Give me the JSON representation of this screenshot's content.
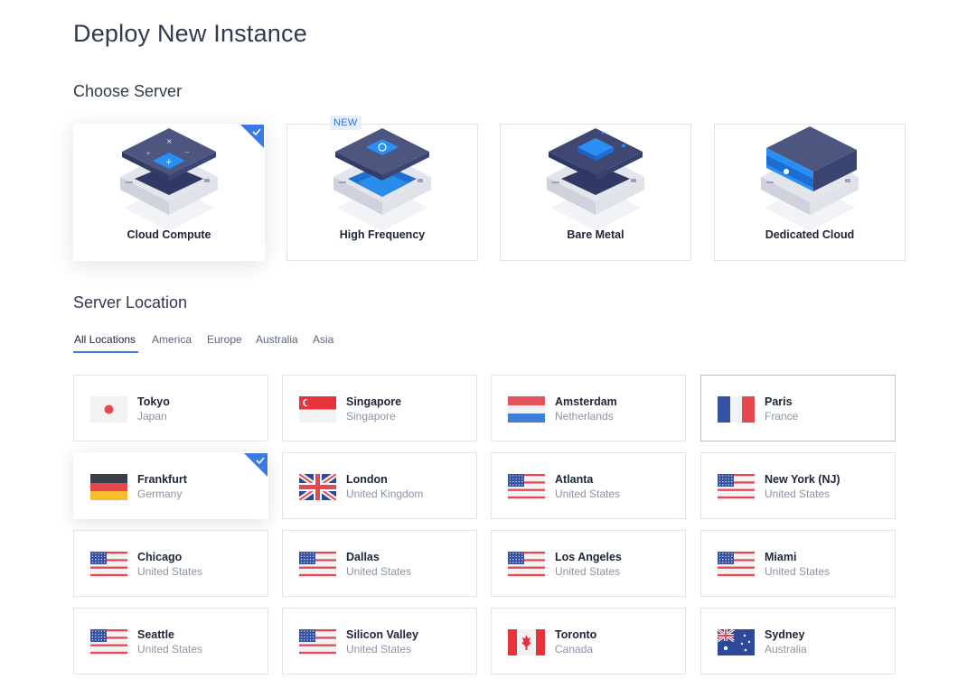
{
  "page": {
    "title": "Deploy New Instance"
  },
  "server": {
    "section_title": "Choose Server",
    "cards": [
      {
        "label": "Cloud Compute",
        "selected": true
      },
      {
        "label": "High Frequency",
        "badge": "NEW"
      },
      {
        "label": "Bare Metal"
      },
      {
        "label": "Dedicated Cloud"
      }
    ]
  },
  "location": {
    "section_title": "Server Location",
    "tabs": [
      "All Locations",
      "America",
      "Europe",
      "Australia",
      "Asia"
    ],
    "active_tab": "All Locations",
    "items": [
      {
        "city": "Tokyo",
        "country": "Japan",
        "flag": "japan-flag-icon"
      },
      {
        "city": "Singapore",
        "country": "Singapore",
        "flag": "singapore-flag-icon"
      },
      {
        "city": "Amsterdam",
        "country": "Netherlands",
        "flag": "netherlands-flag-icon"
      },
      {
        "city": "Paris",
        "country": "France",
        "flag": "france-flag-icon"
      },
      {
        "city": "Frankfurt",
        "country": "Germany",
        "flag": "germany-flag-icon",
        "selected": true
      },
      {
        "city": "London",
        "country": "United Kingdom",
        "flag": "uk-flag-icon"
      },
      {
        "city": "Atlanta",
        "country": "United States",
        "flag": "us-flag-icon"
      },
      {
        "city": "New York (NJ)",
        "country": "United States",
        "flag": "us-flag-icon"
      },
      {
        "city": "Chicago",
        "country": "United States",
        "flag": "us-flag-icon"
      },
      {
        "city": "Dallas",
        "country": "United States",
        "flag": "us-flag-icon"
      },
      {
        "city": "Los Angeles",
        "country": "United States",
        "flag": "us-flag-icon"
      },
      {
        "city": "Miami",
        "country": "United States",
        "flag": "us-flag-icon"
      },
      {
        "city": "Seattle",
        "country": "United States",
        "flag": "us-flag-icon"
      },
      {
        "city": "Silicon Valley",
        "country": "United States",
        "flag": "us-flag-icon"
      },
      {
        "city": "Toronto",
        "country": "Canada",
        "flag": "canada-flag-icon"
      },
      {
        "city": "Sydney",
        "country": "Australia",
        "flag": "australia-flag-icon"
      }
    ]
  },
  "colors": {
    "accent": "#3b79e6",
    "text": "#1d2537",
    "muted": "#8a93a3",
    "border": "#dfe2e8"
  }
}
